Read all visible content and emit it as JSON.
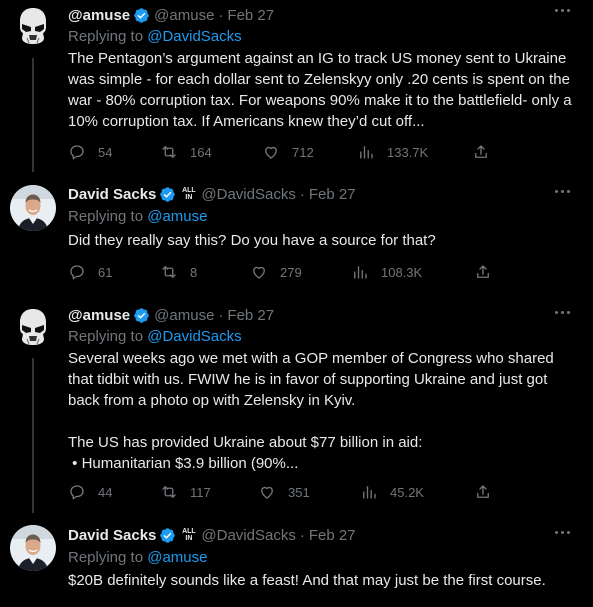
{
  "tweets": [
    {
      "name": "@amuse",
      "handle": "@amuse",
      "dot": "·",
      "date": "Feb 27",
      "replying_label": "Replying to ",
      "replying_to": "@DavidSacks",
      "text_lines": [
        "The Pentagon’s argument against an IG to track US money sent to Ukraine was simple - for each dollar sent to Zelenskyy only .20 cents is spent on the war - 80% corruption tax. For weapons 90% make it to the battlefield- only a 10% corruption tax. If Americans knew they’d cut off..."
      ],
      "stats": {
        "replies": "54",
        "retweets": "164",
        "likes": "712",
        "views": "133.7K"
      }
    },
    {
      "name": "David Sacks",
      "badge_line1": "ALL",
      "badge_line2": "IN",
      "handle": "@DavidSacks",
      "dot": "·",
      "date": "Feb 27",
      "replying_label": "Replying to ",
      "replying_to": "@amuse",
      "text_lines": [
        "Did they really say this? Do you have a source for that?"
      ],
      "stats": {
        "replies": "61",
        "retweets": "8",
        "likes": "279",
        "views": "108.3K"
      }
    },
    {
      "name": "@amuse",
      "handle": "@amuse",
      "dot": "·",
      "date": "Feb 27",
      "replying_label": "Replying to ",
      "replying_to": "@DavidSacks",
      "text_lines": [
        "Several weeks ago we met with a GOP member of Congress who shared that tidbit with us. FWIW he is in favor of supporting Ukraine and just got back from a photo op with Zelensky in Kyiv.",
        "The US has provided Ukraine about $77 billion in aid:",
        " • Humanitarian $3.9 billion (90%..."
      ],
      "stats": {
        "replies": "44",
        "retweets": "117",
        "likes": "351",
        "views": "45.2K"
      }
    },
    {
      "name": "David Sacks",
      "badge_line1": "ALL",
      "badge_line2": "IN",
      "handle": "@DavidSacks",
      "dot": "·",
      "date": "Feb 27",
      "replying_label": "Replying to ",
      "replying_to": "@amuse",
      "text_lines": [
        "$20B definitely sounds like a feast! And that may just be the first course."
      ]
    }
  ],
  "colors": {
    "background": "#000000",
    "text": "#e7e9ea",
    "muted": "#71767b",
    "link": "#1d9bf0",
    "verified": "#1d9bf0",
    "thread_line": "#333639"
  },
  "icons": [
    "stormtrooper-avatar",
    "verified-badge-icon",
    "more-icon",
    "reply-icon",
    "retweet-icon",
    "like-icon",
    "views-icon",
    "share-icon"
  ]
}
